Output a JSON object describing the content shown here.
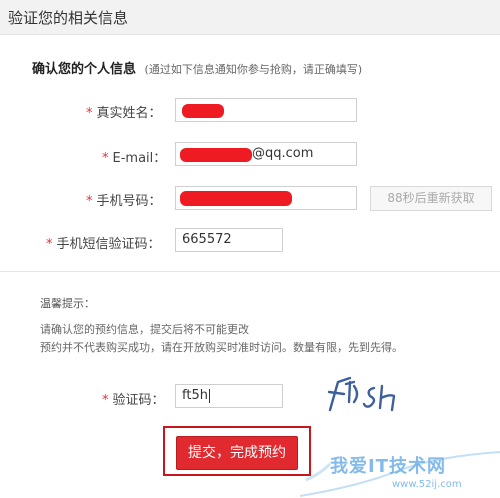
{
  "header": {
    "title": "验证您的相关信息"
  },
  "section": {
    "title": "确认您的个人信息",
    "hint": "(通过如下信息通知你参与抢购，请正确填写)"
  },
  "form": {
    "required_mark": "*",
    "name_label": "真实姓名：",
    "email_label": "E-mail：",
    "email_value_visible": "@qq.com",
    "phone_label": "手机号码：",
    "resend_label": "88秒后重新获取",
    "sms_label": "手机短信验证码：",
    "sms_value": "665572",
    "captcha_label": "验证码：",
    "captcha_value": "ft5h",
    "submit_label": "提交，完成预约"
  },
  "tips": {
    "title": "温馨提示：",
    "items": [
      "请确认您的预约信息，提交后将不可能更改",
      "预约并不代表购买成功，请在开放购买时准时访问。数量有限，先到先得。"
    ]
  },
  "colors": {
    "accent_red": "#e02a30",
    "redaction_red": "#ee1c22",
    "watermark_blue": "#6fb0e8"
  },
  "watermark": {
    "title": "我爱IT技术网",
    "url": "www.52ij.com"
  }
}
